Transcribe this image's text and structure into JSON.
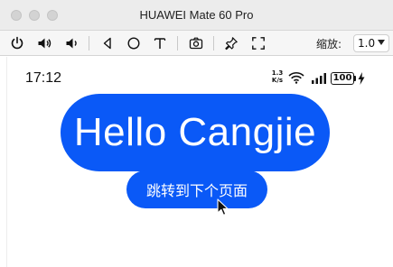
{
  "window": {
    "title": "HUAWEI Mate 60 Pro"
  },
  "toolbar": {
    "icons": [
      "power-icon",
      "volume-up-icon",
      "volume-down-icon",
      "back-icon",
      "home-icon",
      "text-icon",
      "camera-icon",
      "pin-icon",
      "fullscreen-icon"
    ],
    "zoom_label": "缩放:",
    "zoom_value": "1.0"
  },
  "status_bar": {
    "time": "17:12",
    "net_speed_value": "1.3",
    "net_speed_unit": "K/s",
    "battery": "100"
  },
  "content": {
    "headline": "Hello Cangjie",
    "nav_button_label": "跳转到下个页面",
    "accent_color": "#0a59f7"
  }
}
